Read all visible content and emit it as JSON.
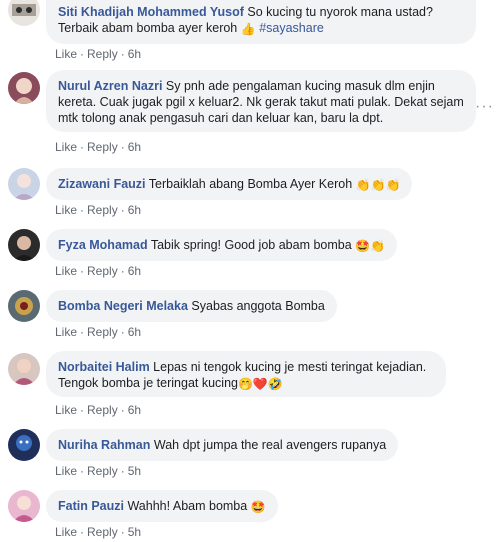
{
  "action_labels": {
    "like": "Like",
    "reply": "Reply",
    "separator": "·"
  },
  "comments": [
    {
      "name": "Siti Khadijah Mohammed Yusof",
      "text": "So kucing tu nyorok mana ustad? Terbaik abam bomba ayer keroh",
      "emoji": "👍",
      "hashtag": "#sayashare",
      "time": "6h",
      "avatar_color": "#e8e4df"
    },
    {
      "name": "Nurul Azren Nazri",
      "text": "Sy pnh ade pengalaman kucing masuk dlm enjin kereta. Cuak jugak pgil x keluar2. Nk gerak takut mati pulak. Dekat sejam mtk tolong anak pengasuh cari dan keluar kan, baru la dpt.",
      "time": "6h",
      "avatar_color": "#8a4b5a"
    },
    {
      "name": "Zizawani Fauzi",
      "text": "Terbaiklah abang Bomba Ayer Keroh",
      "emoji": "👏👏👏",
      "time": "6h",
      "avatar_color": "#c9d4e6"
    },
    {
      "name": "Fyza Mohamad",
      "text": "Tabik spring! Good job abam bomba",
      "emoji": "🤩👏",
      "time": "6h",
      "avatar_color": "#2b2b2b"
    },
    {
      "name": "Bomba Negeri Melaka",
      "text": "Syabas anggota Bomba",
      "time": "6h",
      "avatar_color": "#5a6a72"
    },
    {
      "name": "Norbaitei Halim",
      "text": "Lepas ni tengok kucing je mesti teringat kejadian. Tengok bomba je teringat kucing",
      "emoji": "🤭❤️🤣",
      "time": "6h",
      "avatar_color": "#d8c7c0"
    },
    {
      "name": "Nuriha Rahman",
      "text": "Wah dpt jumpa the real avengers rupanya",
      "time": "5h",
      "avatar_color": "#1f2f5a"
    },
    {
      "name": "Fatin Pauzi",
      "text": "Wahhh! Abam bomba",
      "emoji": "🤩",
      "time": "5h",
      "avatar_color": "#e9b7cf"
    }
  ],
  "more_icon": "ellipsis-horizontal-icon"
}
